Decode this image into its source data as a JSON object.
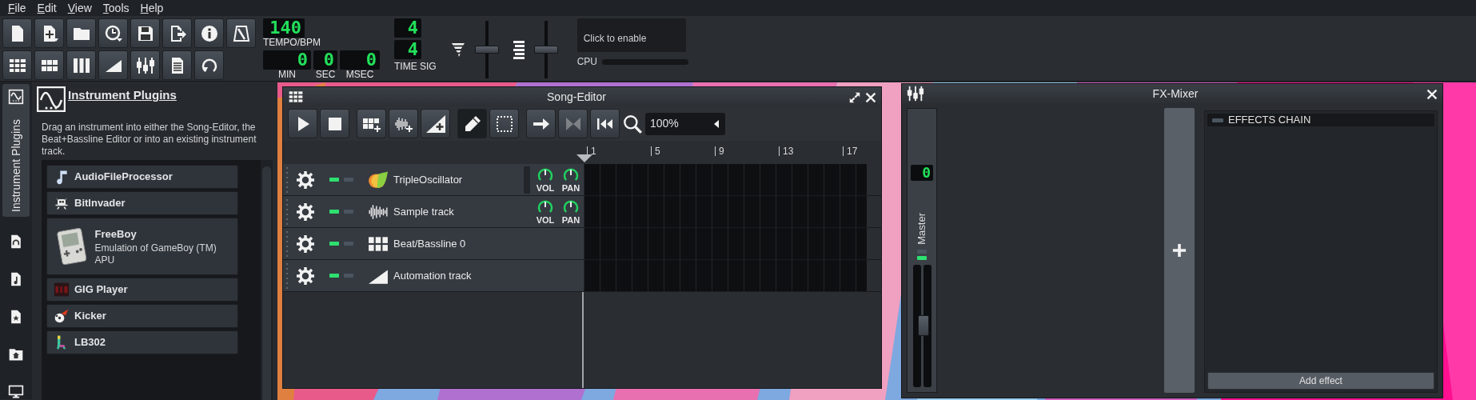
{
  "menu": [
    {
      "label": "File"
    },
    {
      "label": "Edit"
    },
    {
      "label": "View"
    },
    {
      "label": "Tools"
    },
    {
      "label": "Help"
    }
  ],
  "tempo": {
    "value": "140",
    "label": "TEMPO/BPM"
  },
  "time": [
    {
      "value": "0",
      "label": "MIN"
    },
    {
      "value": "0",
      "label": "SEC"
    },
    {
      "value": "0",
      "label": "MSEC"
    }
  ],
  "time_sig": {
    "numerator": "4",
    "denominator": "4",
    "label": "TIME SIG"
  },
  "master_volume": {
    "level": 0.5
  },
  "master_pitch": {
    "level": 0.5
  },
  "cpu": {
    "message": "Click to enable",
    "label": "CPU"
  },
  "side_tabs": [
    {
      "label": "Instrument Plugins",
      "selected": true
    },
    {
      "selected": false
    },
    {
      "selected": false
    },
    {
      "selected": false
    },
    {
      "selected": false
    },
    {
      "selected": false
    }
  ],
  "plugin_browser": {
    "title": "Instrument Plugins",
    "hint": "Drag an instrument into either the Song-Editor, the Beat+Bassline Editor or into an existing instrument track.",
    "plugins": [
      {
        "name": "AudioFileProcessor"
      },
      {
        "name": "BitInvader"
      },
      {
        "name": "FreeBoy",
        "description": "Emulation of GameBoy (TM) APU"
      },
      {
        "name": "GIG Player"
      },
      {
        "name": "Kicker"
      },
      {
        "name": "LB302"
      }
    ]
  },
  "song_editor": {
    "title": "Song-Editor",
    "transport": [
      {
        "kind": "play"
      },
      {
        "kind": "stop"
      }
    ],
    "add_track": [
      {
        "kind": "beat"
      },
      {
        "kind": "sample"
      },
      {
        "kind": "automation"
      }
    ],
    "edit_modes": [
      {
        "kind": "draw",
        "selected": true
      },
      {
        "kind": "select",
        "selected": false
      }
    ],
    "view_tools": [
      {
        "kind": "follow",
        "disabled": false
      },
      {
        "kind": "loop",
        "disabled": true
      },
      {
        "kind": "rewind",
        "disabled": false
      }
    ],
    "zoom": "100%",
    "bar_numbers": [
      "1",
      "5",
      "9",
      "13",
      "17"
    ],
    "tracks": [
      {
        "kind": "instrument",
        "name": "TripleOscillator",
        "muted": false,
        "solo": false,
        "knobs": [
          {
            "label": "VOL"
          },
          {
            "label": "PAN"
          }
        ]
      },
      {
        "kind": "sample",
        "name": "Sample track",
        "muted": false,
        "solo": false,
        "knobs": [
          {
            "label": "VOL"
          },
          {
            "label": "PAN"
          }
        ]
      },
      {
        "kind": "beat",
        "name": "Beat/Bassline 0",
        "muted": false,
        "solo": false
      },
      {
        "kind": "automation",
        "name": "Automation track",
        "muted": false,
        "solo": false
      }
    ]
  },
  "fx_mixer": {
    "title": "FX-Mixer",
    "master": {
      "number": "0",
      "name": "Master",
      "muted": false,
      "solo": false,
      "fader": {
        "level": 0.5
      }
    },
    "effects_chain": {
      "title": "EFFECTS CHAIN",
      "enabled": false,
      "button": "Add effect"
    }
  }
}
